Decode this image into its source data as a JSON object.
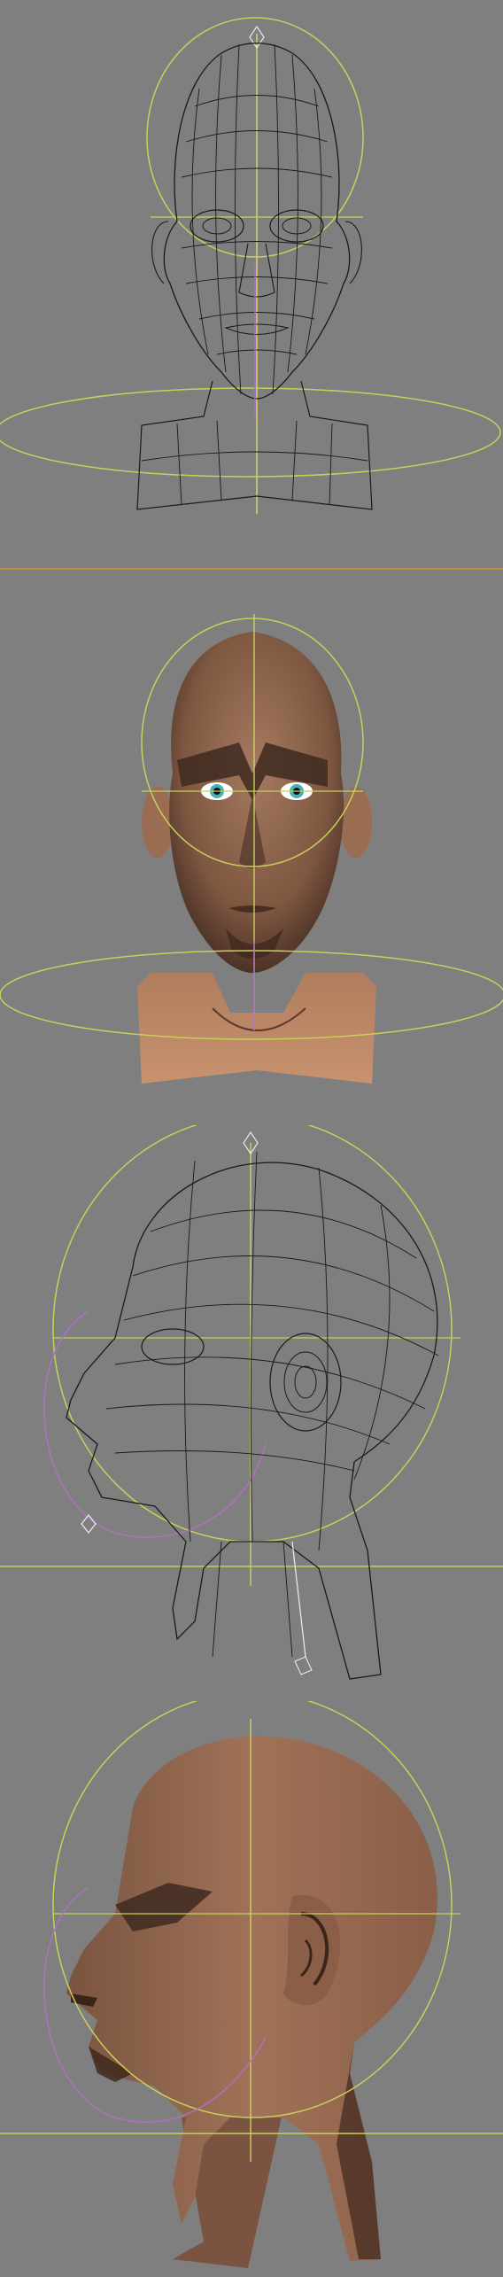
{
  "viewports": [
    {
      "view": "front",
      "shading": "wireframe"
    },
    {
      "view": "front",
      "shading": "smooth-shaded"
    },
    {
      "view": "side",
      "shading": "wireframe"
    },
    {
      "view": "side",
      "shading": "smooth-shaded"
    }
  ],
  "colors": {
    "background": "#7f7f7f",
    "wire": "#1a1a1a",
    "helper": "#c8d05a",
    "bone": "#f0f0f0",
    "accent_purple": "#b070c0",
    "separator": "#c08a30",
    "skin": "#9a6c52",
    "skin_dark": "#5a3a2a",
    "eye_iris": "#4ab0b8"
  }
}
